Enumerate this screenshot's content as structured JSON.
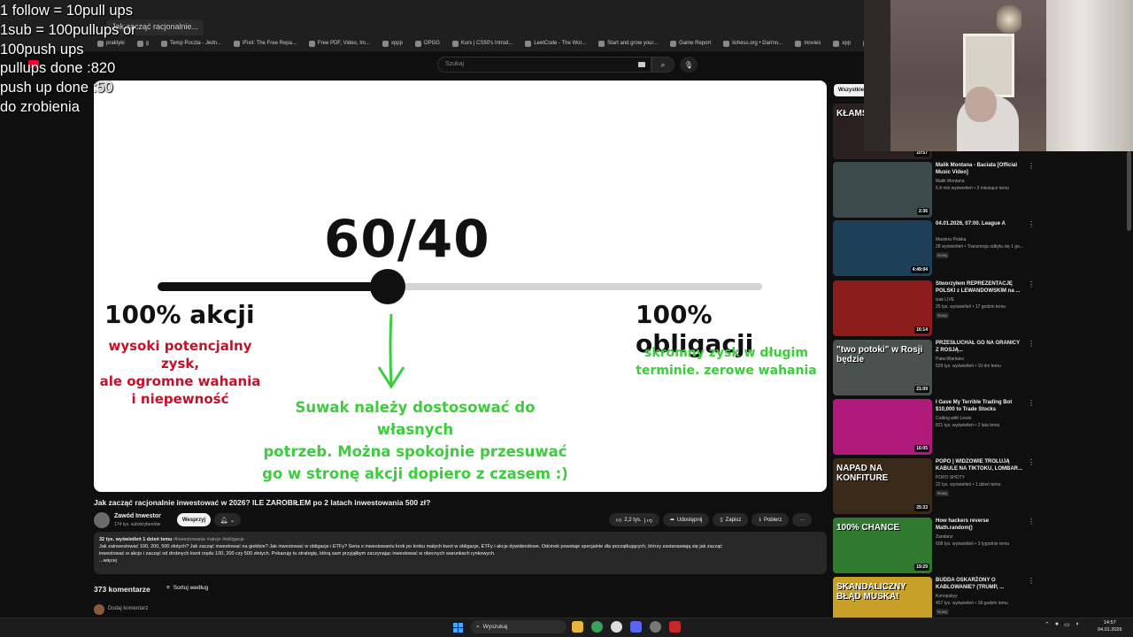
{
  "browser": {
    "tab_title": "Jak zacząć racjonalnie...",
    "url_fragment": "/watch?v=...tl5u464",
    "bookmarks": [
      "praktyki",
      "g",
      "Temp Poczta - Jedn...",
      "iFixit: The Free Repa...",
      "Free PDF, Video, Im...",
      "xppp",
      "OPGG",
      "Kurs | CS50's Introd...",
      "LeetCode - The Wor...",
      "Start and grow your...",
      "Game Report",
      "lichess.org • Darmo...",
      "movies",
      "xpp",
      "Społeczność Steam..."
    ]
  },
  "youtube": {
    "search_placeholder": "Szukaj",
    "search_icon": "search-icon",
    "mic_icon": "mic-icon"
  },
  "slide": {
    "ratio": "60/40",
    "slider_position_percent": 38,
    "left_label": "100% akcji",
    "right_label": "100% obligacji",
    "left_note": [
      "wysoki potencjalny zysk,",
      "ale ogromne wahania",
      "i niepewność"
    ],
    "right_note": [
      "skromny zysk w długim",
      "terminie. zerowe wahania"
    ],
    "center_note": [
      "Suwak należy dostosować do własnych",
      "potrzeb. Można spokojnie przesuwać",
      "go w stronę akcji dopiero z czasem :)"
    ],
    "colors": {
      "red": "#c3122a",
      "green": "#3dcc3d",
      "dark": "#111111",
      "track": "#d4d4d4"
    }
  },
  "video": {
    "title": "Jak zacząć racjonalnie inwestować w 2026? ILE ZAROBIŁEM po 2 latach inwestowania 500 zł?",
    "channel": "Zawód Inwestor",
    "subscribers": "174 tys. subskrybentów",
    "support_label": "Wesprzyj",
    "likes": "2,2 tys.",
    "share_label": "Udostępnij",
    "save_label": "Zapisz",
    "download_label": "Pobierz",
    "description": {
      "stats": "32 tys. wyświetleń  1 dzień temu",
      "tags": "#inwestowanie #akcje #obligacje",
      "line1": "Jak zainwestować 100, 200, 500 złotych? Jak zacząć inwestować na giełdzie? Jak inwestować w obligacje i ETFy? Seria o inwestowaniu krok po kroku małych kwot w obligacje, ETFy i akcje dywidendowe. Odcinek powstaje specjalnie dla początkujących, którzy zastanawiają się jak zacząć",
      "line2": "inwestować w akcje i zacząć od drobnych kwot rzędu 100, 200 czy 500 złotych. Pokazuję tu strategię, którą sam przyjąłbym zaczynając inwestować w obecnych warunkach rynkowych.",
      "more": "...więcej"
    },
    "comments_count": "373 komentarze",
    "sort_label": "Sortuj według",
    "add_comment_placeholder": "Dodaj komentarz"
  },
  "sidebar": {
    "chip": "Wszystkie",
    "items": [
      {
        "title": "",
        "channel": "",
        "meta": "",
        "duration": "10:57",
        "thumb_text": "KŁAMS O BRZ",
        "badge": ""
      },
      {
        "title": "Malik Montana - Baciata [Official Music Video]",
        "channel": "Malik Montana",
        "meta": "5,4 mln wyświetleń • 3 miesiące temu",
        "duration": "2:36",
        "badge": ""
      },
      {
        "title": "04.01.2026, 07:00. League A",
        "channel": "Mastera Polska",
        "meta": "28 wyświetleń • Transmisja odbyła się 1 go...",
        "duration": "4:49:04",
        "badge": "Nowy"
      },
      {
        "title": "Stworzyłem REPREZENTACJĘ POLSKI z LEWANDOWSKIM na ...",
        "channel": "izak LIVE",
        "meta": "25 tys. wyświetleń • 17 godzin temu",
        "duration": "16:14",
        "badge": "Nowy"
      },
      {
        "title": "PRZESŁUCHAŁ GO NA GRANICY Z ROSJĄ...",
        "channel": "PatecWarlatec",
        "meta": "529 tys. wyświetleń • 10 dni temu",
        "duration": "21:09",
        "thumb_text": "\"two potoki\" w Rosji będzie",
        "badge": ""
      },
      {
        "title": "I Gave My Terrible Trading Bot $10,000 to Trade Stocks",
        "channel": "Coding with Lewis",
        "meta": "821 tys. wyświetleń • 2 lata temu",
        "duration": "16:05",
        "badge": ""
      },
      {
        "title": "POPO | WIDZOWIE TROLUJĄ KABULE NA TIKTOKU, LOMBAR...",
        "channel": "POPO SHOTY",
        "meta": "22 tys. wyświetleń • 1 dzień temu",
        "duration": "25:33",
        "thumb_text": "NAPAD NA KONFITURE",
        "badge": "Nowy"
      },
      {
        "title": "How hackers reverse Math.random()",
        "channel": "Zandanz",
        "meta": "608 tys. wyświetleń • 3 tygodnie temu",
        "duration": "19:29",
        "thumb_text": "100% CHANCE",
        "badge": ""
      },
      {
        "title": "BUDDA OSKARŻONY O KABLOWANIE? (TRUMP, ...",
        "channel": "Konopskyy",
        "meta": "457 tys. wyświetleń • 18 godzin temu",
        "duration": "",
        "thumb_text": "SKANDALICZNY BŁĄD MUSKA!",
        "badge": "Nowy"
      }
    ]
  },
  "overlay": {
    "lines": [
      "1 follow = 10pull ups",
      "1sub = 100pullups or",
      "100push ups",
      "pullups done :820",
      "push up done :50",
      "do zrobienia"
    ]
  },
  "taskbar": {
    "search_label": "Wyszukaj",
    "time": "14:57",
    "date": "04.01.2026"
  }
}
